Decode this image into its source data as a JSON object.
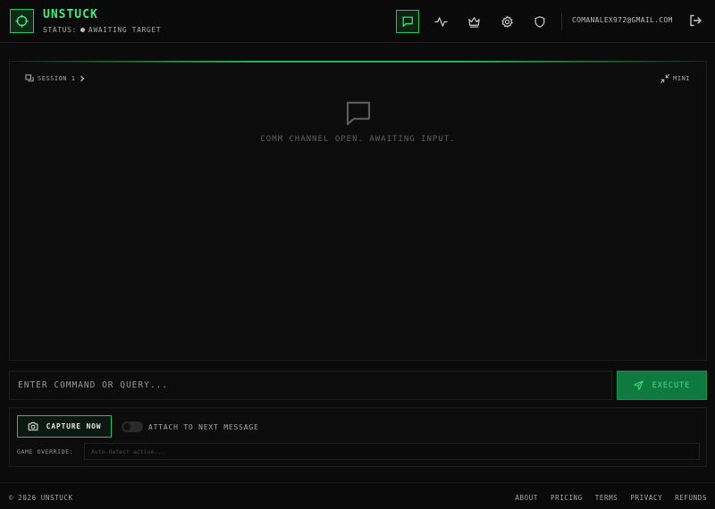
{
  "app": {
    "title": "UNSTUCK",
    "status_label": "STATUS:",
    "status_value": "AWAITING TARGET"
  },
  "nav": {
    "items": [
      {
        "icon": "chat-icon",
        "active": true
      },
      {
        "icon": "activity-icon",
        "active": false
      },
      {
        "icon": "crown-icon",
        "active": false
      },
      {
        "icon": "gear-icon",
        "active": false
      },
      {
        "icon": "shield-icon",
        "active": false
      }
    ],
    "user_email": "COMANALEX972@GMAIL.COM"
  },
  "chat": {
    "session_label": "SESSION 1",
    "mini_label": "MINI",
    "empty_message": "COMM CHANNEL OPEN. AWAITING INPUT."
  },
  "command": {
    "placeholder": "ENTER COMMAND OR QUERY...",
    "execute_label": "EXECUTE"
  },
  "tools": {
    "capture_label": "CAPTURE NOW",
    "attach_label": "ATTACH TO NEXT MESSAGE",
    "attach_enabled": false,
    "override_label": "GAME OVERRIDE:",
    "override_placeholder": "Auto-detect active..."
  },
  "footer": {
    "copyright": "© 2026 UNSTUCK",
    "links": [
      "ABOUT",
      "PRICING",
      "TERMS",
      "PRIVACY",
      "REFUNDS"
    ]
  },
  "colors": {
    "accent": "#22c55e",
    "accent_bright": "#39f07a",
    "execute_bg": "#0f7a3f",
    "background": "#0b0b0b"
  }
}
